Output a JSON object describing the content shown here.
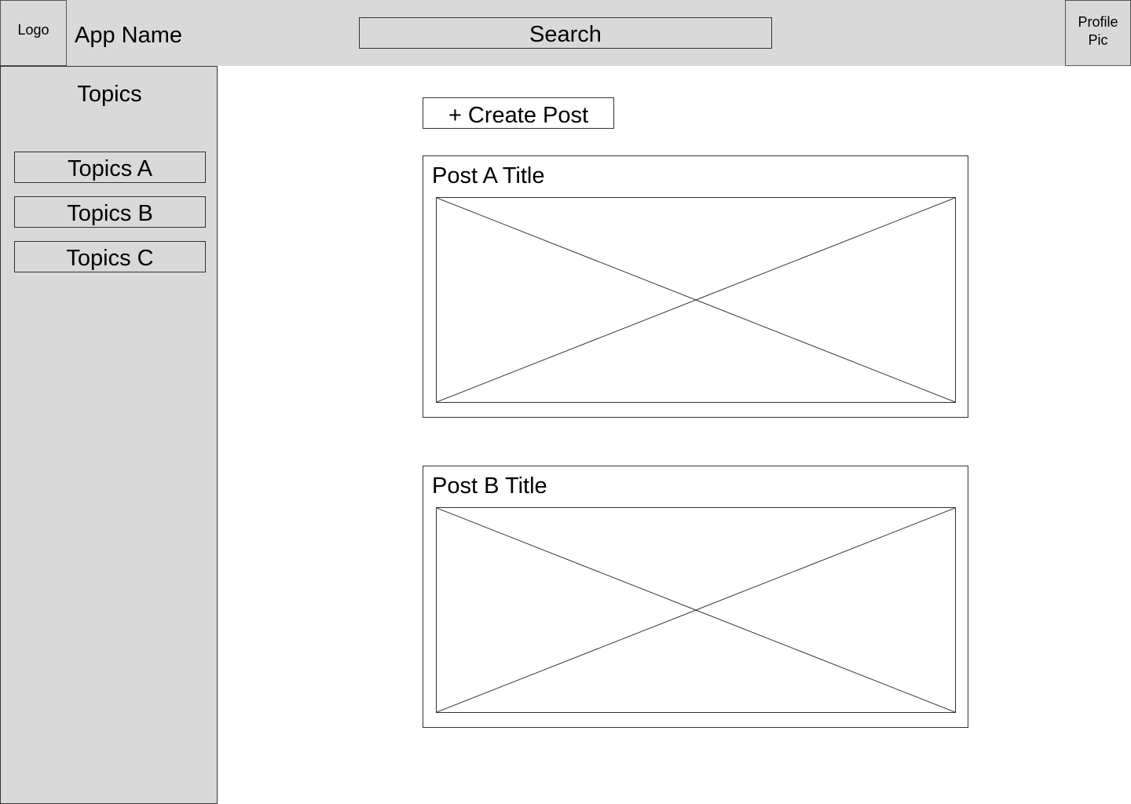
{
  "header": {
    "logo": "Logo",
    "app_name": "App Name",
    "search": "Search",
    "profile_line1": "Profile",
    "profile_line2": "Pic"
  },
  "sidebar": {
    "title": "Topics",
    "items": [
      {
        "label": "Topics A"
      },
      {
        "label": "Topics B"
      },
      {
        "label": "Topics C"
      }
    ]
  },
  "main": {
    "create_post_label": "+ Create Post",
    "posts": [
      {
        "title": "Post A Title"
      },
      {
        "title": "Post B Title"
      }
    ]
  },
  "colors": {
    "panel_background": "#d9d9d9",
    "border": "#333333",
    "page_background": "#ffffff"
  }
}
